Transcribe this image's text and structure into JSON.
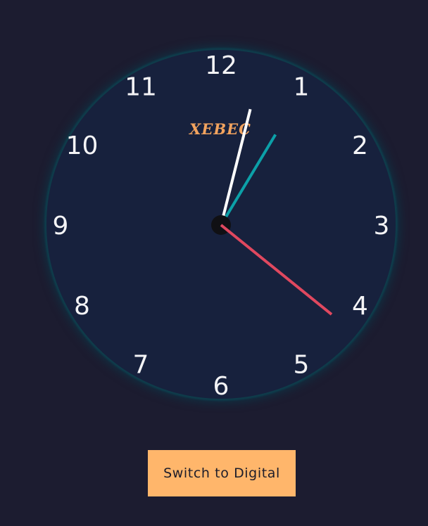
{
  "clock": {
    "brand": "XEBEC",
    "numerals": [
      "12",
      "1",
      "2",
      "3",
      "4",
      "5",
      "6",
      "7",
      "8",
      "9",
      "10",
      "11"
    ],
    "time": {
      "hours": 1,
      "minutes": 2,
      "seconds": 21.5
    },
    "colors": {
      "hour_hand": "#0ca0a8",
      "minute_hand": "#ffffff",
      "second_hand": "#e0485f",
      "center_cap": "#101014",
      "face": "#17213d",
      "numerals": "#f4f4f6",
      "brand": "#f2a35e"
    }
  },
  "controls": {
    "switch_label": "Switch to Digital",
    "button_color": "#ffb66b"
  }
}
